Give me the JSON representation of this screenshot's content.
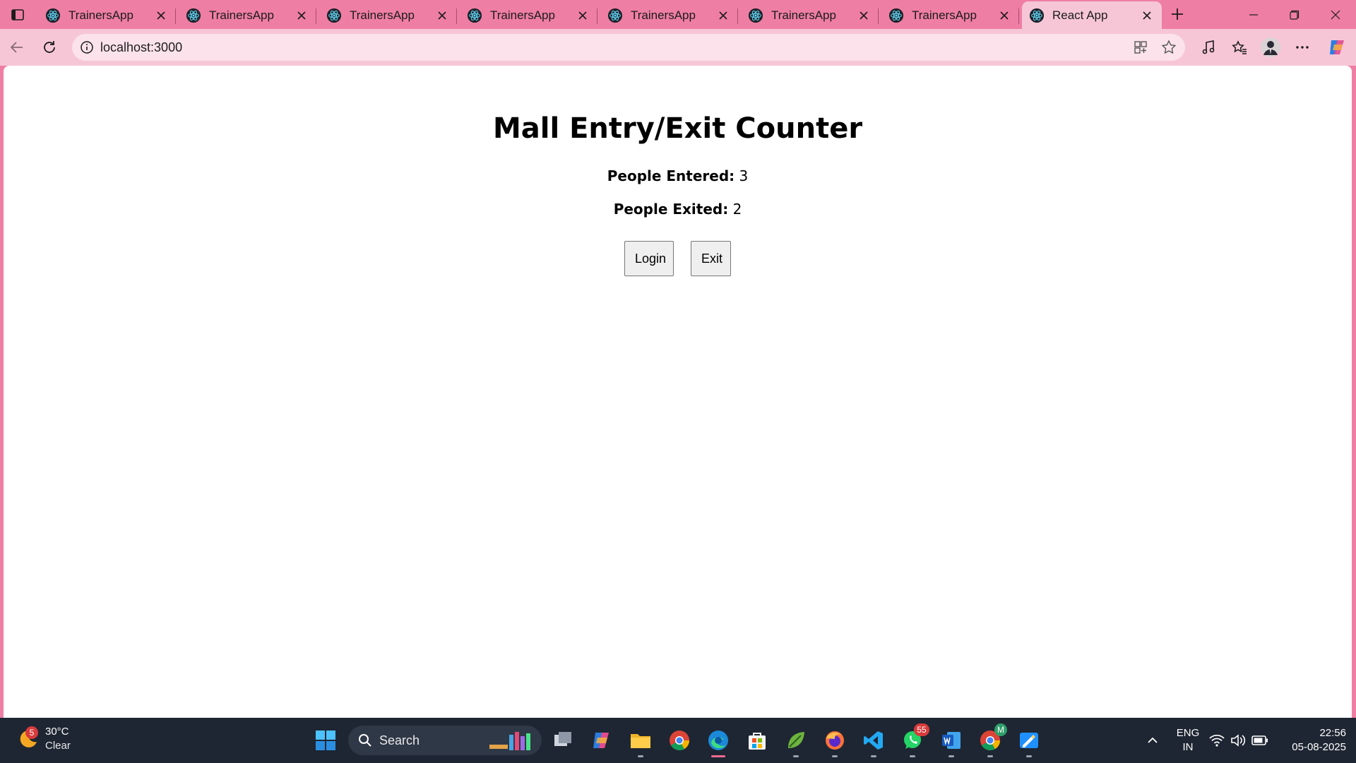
{
  "browser": {
    "tabs": [
      {
        "label": "TrainersApp",
        "active": false
      },
      {
        "label": "TrainersApp",
        "active": false
      },
      {
        "label": "TrainersApp",
        "active": false
      },
      {
        "label": "TrainersApp",
        "active": false
      },
      {
        "label": "TrainersApp",
        "active": false
      },
      {
        "label": "TrainersApp",
        "active": false
      },
      {
        "label": "TrainersApp",
        "active": false
      },
      {
        "label": "React App",
        "active": true
      }
    ],
    "url": "localhost:3000",
    "accent": "#ef7ea4",
    "toolbar_color": "#f6c6d7"
  },
  "page": {
    "title": "Mall Entry/Exit Counter",
    "entered_label": "People Entered:",
    "entered_value": "3",
    "exited_label": "People Exited:",
    "exited_value": "2",
    "login_button": "Login",
    "exit_button": "Exit"
  },
  "taskbar": {
    "weather_temp": "30°C",
    "weather_desc": "Clear",
    "weather_badge": "5",
    "search_label": "Search",
    "whatsapp_badge": "55",
    "chrome_badge": "M",
    "lang_line1": "ENG",
    "lang_line2": "IN",
    "time": "22:56",
    "date": "05-08-2025"
  }
}
